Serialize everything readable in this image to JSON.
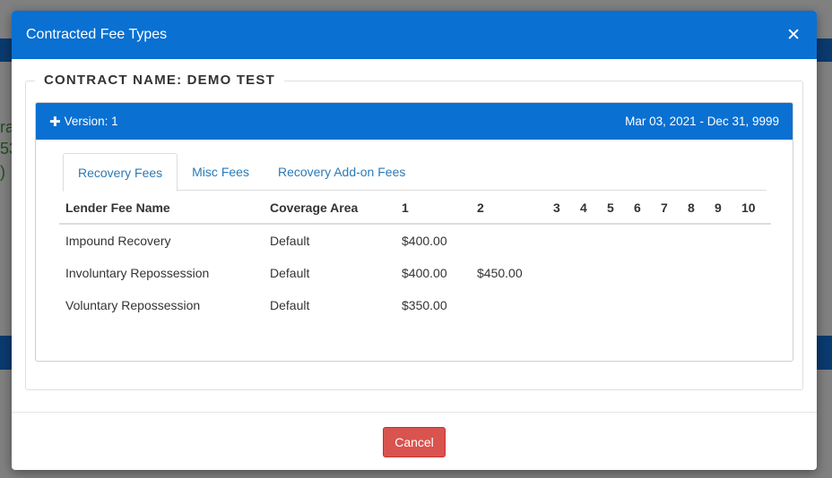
{
  "modal": {
    "title": "Contracted Fee Types",
    "close_glyph": "✕"
  },
  "contract": {
    "legend": "CONTRACT NAME: DEMO TEST"
  },
  "version": {
    "label": "Version: 1",
    "date_range": "Mar 03, 2021 - Dec 31, 9999"
  },
  "tabs": [
    {
      "label": "Recovery Fees",
      "active": true
    },
    {
      "label": "Misc Fees",
      "active": false
    },
    {
      "label": "Recovery Add-on Fees",
      "active": false
    }
  ],
  "table": {
    "headers": [
      "Lender Fee Name",
      "Coverage Area",
      "1",
      "2",
      "3",
      "4",
      "5",
      "6",
      "7",
      "8",
      "9",
      "10"
    ],
    "rows": [
      [
        "Impound Recovery",
        "Default",
        "$400.00",
        "",
        "",
        "",
        "",
        "",
        "",
        "",
        "",
        ""
      ],
      [
        "Involuntary Repossession",
        "Default",
        "$400.00",
        "$450.00",
        "",
        "",
        "",
        "",
        "",
        "",
        "",
        ""
      ],
      [
        "Voluntary Repossession",
        "Default",
        "$350.00",
        "",
        "",
        "",
        "",
        "",
        "",
        "",
        "",
        ""
      ]
    ]
  },
  "footer": {
    "cancel_label": "Cancel"
  },
  "colors": {
    "header_blue": "#0a70d2",
    "cancel_red": "#d9534f",
    "tab_link": "#2a7ab8"
  }
}
